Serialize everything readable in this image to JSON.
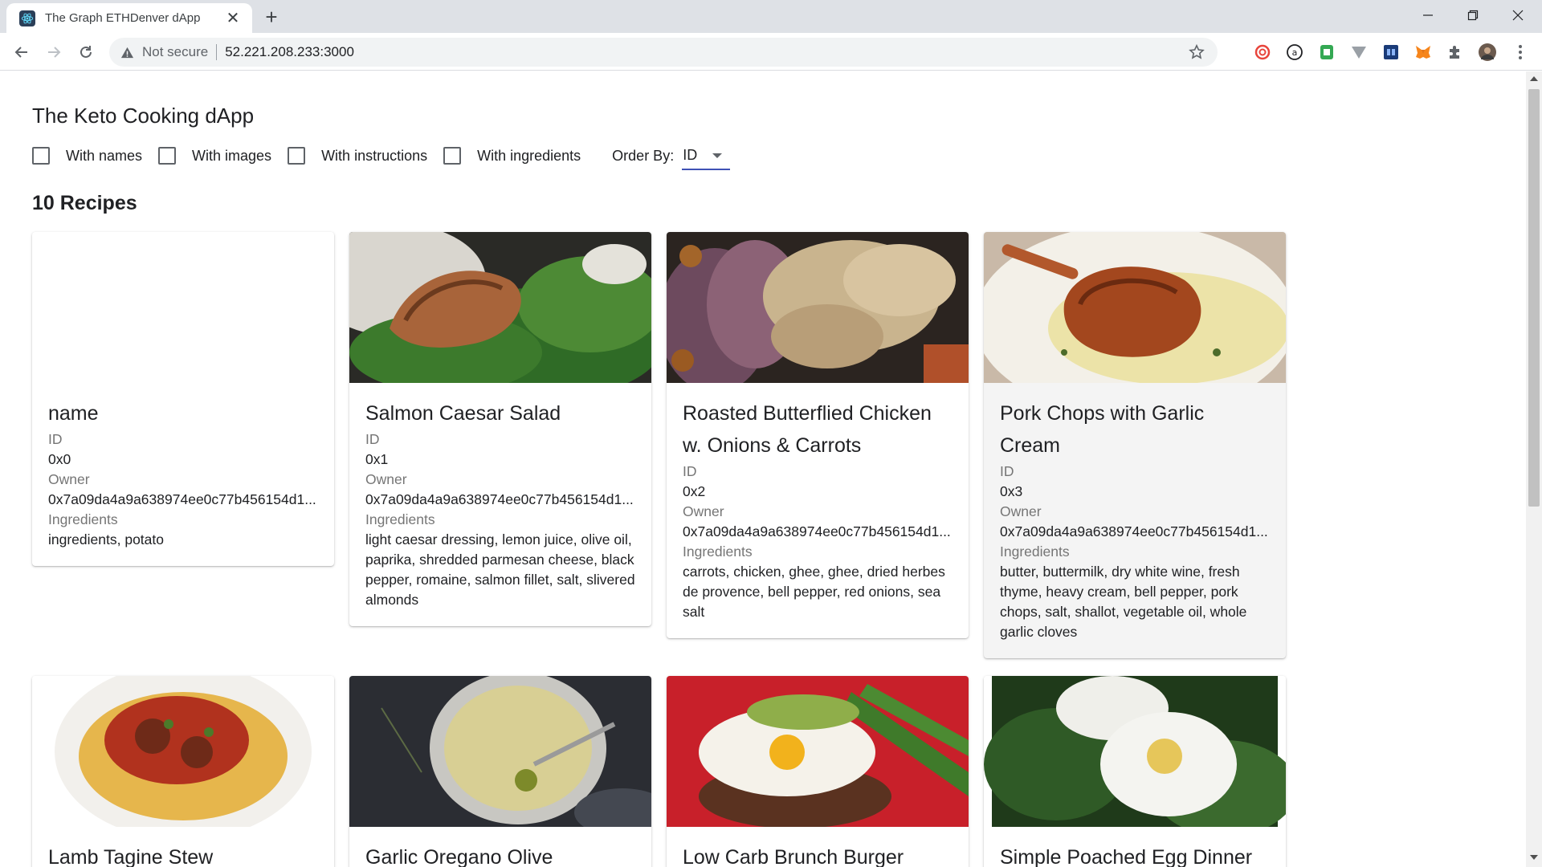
{
  "browser": {
    "tab_title": "The Graph ETHDenver dApp",
    "address_security": "Not secure",
    "address_url": "52.221.208.233:3000"
  },
  "app": {
    "title": "The Keto Cooking dApp",
    "filters": [
      {
        "label": "With names",
        "checked": false
      },
      {
        "label": "With images",
        "checked": false
      },
      {
        "label": "With instructions",
        "checked": false
      },
      {
        "label": "With ingredients",
        "checked": false
      }
    ],
    "order_by_label": "Order By:",
    "order_by_value": "ID",
    "recipe_count": "10 Recipes",
    "field_labels": {
      "id": "ID",
      "owner": "Owner",
      "ingredients": "Ingredients"
    },
    "recipes": [
      {
        "name": "name",
        "id": "0x0",
        "owner": "0x7a09da4a9a638974ee0c77b456154d1...",
        "ingredients": "ingredients, potato",
        "image": "none"
      },
      {
        "name": "Salmon Caesar Salad",
        "id": "0x1",
        "owner": "0x7a09da4a9a638974ee0c77b456154d1...",
        "ingredients": "light caesar dressing, lemon juice, olive oil, paprika, shredded parmesan cheese, black pepper, romaine, salmon fillet, salt, slivered almonds",
        "image": "salmon-salad-photo"
      },
      {
        "name": "Roasted Butterflied Chicken w. Onions & Carrots",
        "id": "0x2",
        "owner": "0x7a09da4a9a638974ee0c77b456154d1...",
        "ingredients": "carrots, chicken, ghee, ghee, dried herbes de provence, bell pepper, red onions, sea salt",
        "image": "roast-chicken-photo"
      },
      {
        "name": "Pork Chops with Garlic Cream",
        "id": "0x3",
        "owner": "0x7a09da4a9a638974ee0c77b456154d1...",
        "ingredients": "butter, buttermilk, dry white wine, fresh thyme, heavy cream, bell pepper, pork chops, salt, shallot, vegetable oil, whole garlic cloves",
        "image": "pork-chop-photo"
      },
      {
        "name": "Lamb Tagine Stew",
        "image": "lamb-stew-photo"
      },
      {
        "name": "Garlic Oregano Olive",
        "image": "olive-dip-photo"
      },
      {
        "name": "Low Carb Brunch Burger",
        "image": "burger-photo"
      },
      {
        "name": "Simple Poached Egg Dinner",
        "image": "poached-egg-photo"
      }
    ]
  }
}
